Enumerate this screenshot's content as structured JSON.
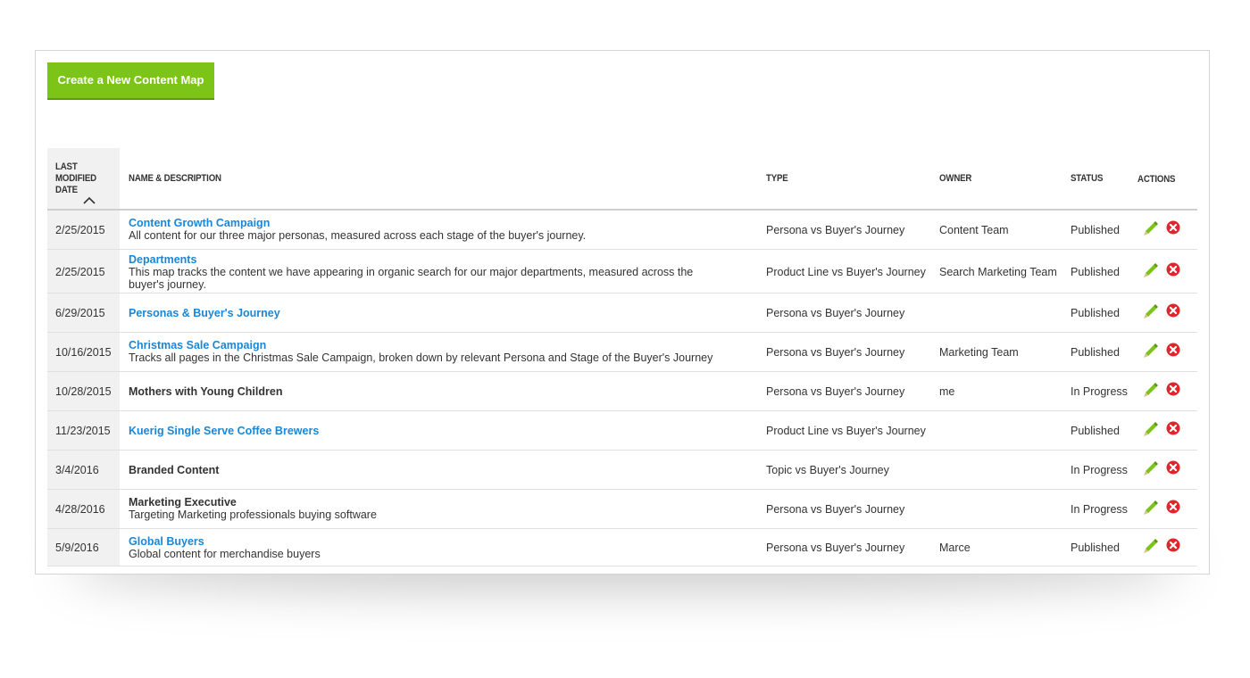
{
  "toolbar": {
    "create_label": "Create a New Content Map"
  },
  "table": {
    "headers": {
      "date_line1": "Last",
      "date_line2": "Modified",
      "date_line3": "Date",
      "name": "Name & Description",
      "type": "Type",
      "owner": "Owner",
      "status": "Status",
      "actions": "Actions"
    },
    "sort": {
      "column": "date",
      "direction": "ascending",
      "icon": "chevron-up-icon"
    },
    "rows": [
      {
        "date": "2/25/2015",
        "name": "Content Growth Campaign",
        "linked": true,
        "description": "All content for our three major personas, measured across each stage of the buyer's journey.",
        "type": "Persona vs Buyer's Journey",
        "owner": "Content Team",
        "status": "Published"
      },
      {
        "date": "2/25/2015",
        "name": "Departments",
        "linked": true,
        "description": "This map tracks the content we have appearing in organic search for our major departments, measured across the buyer's journey.",
        "type": "Product Line vs Buyer's Journey",
        "owner": "Search Marketing Team",
        "status": "Published"
      },
      {
        "date": "6/29/2015",
        "name": "Personas & Buyer's Journey",
        "linked": true,
        "description": "",
        "type": "Persona vs Buyer's Journey",
        "owner": "",
        "status": "Published"
      },
      {
        "date": "10/16/2015",
        "name": "Christmas Sale Campaign",
        "linked": true,
        "description": "Tracks all pages in the Christmas Sale Campaign, broken down by relevant Persona and Stage of the Buyer's Journey",
        "type": "Persona vs Buyer's Journey",
        "owner": "Marketing Team",
        "status": "Published"
      },
      {
        "date": "10/28/2015",
        "name": "Mothers with Young Children",
        "linked": false,
        "description": "",
        "type": "Persona vs Buyer's Journey",
        "owner": "me",
        "status": "In Progress"
      },
      {
        "date": "11/23/2015",
        "name": "Kuerig Single Serve Coffee Brewers",
        "linked": true,
        "description": "",
        "type": "Product Line vs Buyer's Journey",
        "owner": "",
        "status": "Published"
      },
      {
        "date": "3/4/2016",
        "name": "Branded Content",
        "linked": false,
        "description": "",
        "type": "Topic vs Buyer's Journey",
        "owner": "",
        "status": "In Progress"
      },
      {
        "date": "4/28/2016",
        "name": "Marketing Executive",
        "linked": false,
        "description": "Targeting Marketing professionals buying software",
        "type": "Persona vs Buyer's Journey",
        "owner": "",
        "status": "In Progress"
      },
      {
        "date": "5/9/2016",
        "name": "Global Buyers",
        "linked": true,
        "description": "Global content for merchandise buyers",
        "type": "Persona vs Buyer's Journey",
        "owner": "Marce",
        "status": "Published"
      }
    ],
    "row_actions": {
      "edit_icon": "pencil-icon",
      "delete_icon": "delete-circle-icon"
    }
  },
  "colors": {
    "accent_green": "#7cc418",
    "link_blue": "#1a87d6",
    "edit_green": "#7cc418",
    "delete_red": "#e0262d"
  }
}
